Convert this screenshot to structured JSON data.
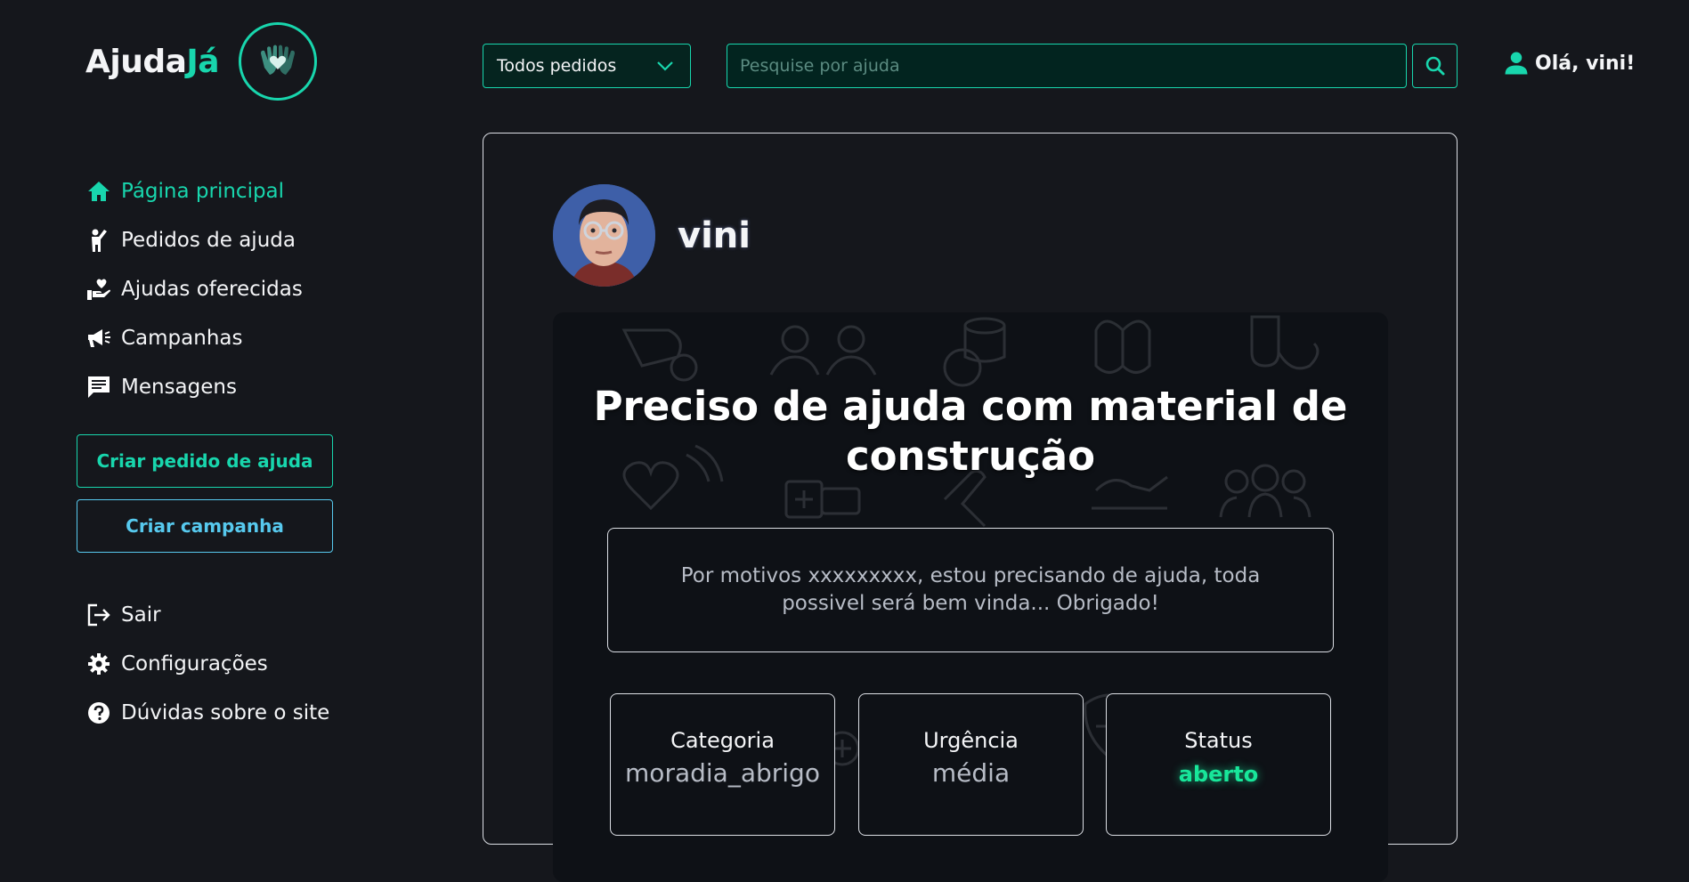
{
  "brand": {
    "name_main": "Ajuda",
    "name_accent": "Já",
    "accent_color": "#18d6ad"
  },
  "header": {
    "filter_selected": "Todos pedidos",
    "search_placeholder": "Pesquise por ajuda",
    "greeting": "Olá, vini!"
  },
  "sidebar": {
    "items": [
      {
        "label": "Página principal",
        "icon": "home-icon",
        "active": true
      },
      {
        "label": "Pedidos de ajuda",
        "icon": "person-raising-hand-icon"
      },
      {
        "label": "Ajudas oferecidas",
        "icon": "hand-holding-heart-icon"
      },
      {
        "label": "Campanhas",
        "icon": "megaphone-icon"
      },
      {
        "label": "Mensagens",
        "icon": "message-icon"
      }
    ],
    "create_request_label": "Criar pedido de ajuda",
    "create_campaign_label": "Criar campanha",
    "bottom_items": [
      {
        "label": "Sair",
        "icon": "logout-icon"
      },
      {
        "label": "Configurações",
        "icon": "gear-icon"
      },
      {
        "label": "Dúvidas sobre o site",
        "icon": "question-icon"
      }
    ]
  },
  "post": {
    "author": "vini",
    "title": "Preciso de ajuda com material de construção",
    "description": "Por motivos xxxxxxxxx, estou precisando de ajuda, toda possivel será bem vinda... Obrigado!",
    "info": [
      {
        "label": "Categoria",
        "value": "moradia_abrigo"
      },
      {
        "label": "Urgência",
        "value": "média"
      },
      {
        "label": "Status",
        "value": "aberto",
        "color": "#18e69a"
      }
    ]
  }
}
